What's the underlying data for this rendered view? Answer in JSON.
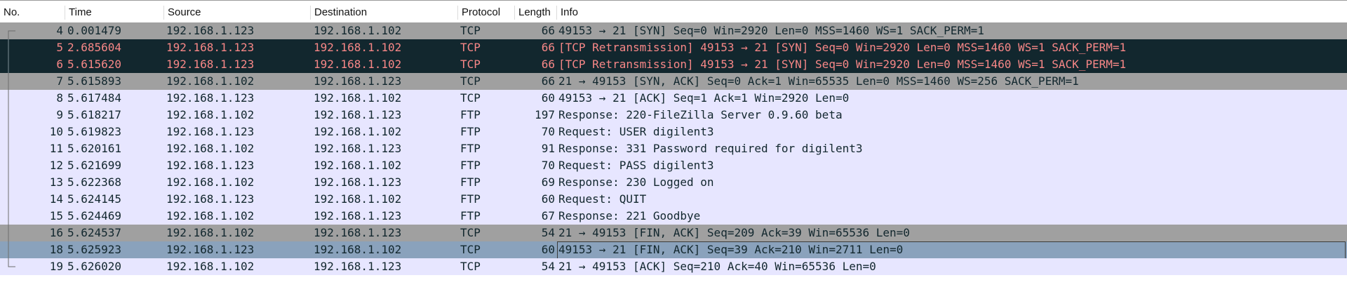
{
  "columns": {
    "no": "No.",
    "time": "Time",
    "source": "Source",
    "destination": "Destination",
    "protocol": "Protocol",
    "length": "Length",
    "info": "Info"
  },
  "colors": {
    "tcp_row_bg": "#a0a0a0",
    "ftp_row_bg": "#e7e6ff",
    "bad_tcp_bg": "#12272e",
    "bad_tcp_fg": "#f78787",
    "selected_bg": "#8aa2bc",
    "row_fg": "#12272e"
  },
  "packets": [
    {
      "no": "4",
      "time": "0.001479",
      "source": "192.168.1.123",
      "destination": "192.168.1.102",
      "protocol": "TCP",
      "length": "66",
      "info": "49153 → 21 [SYN] Seq=0 Win=2920 Len=0 MSS=1460 WS=1 SACK_PERM=1",
      "style": "tcp",
      "tree": "first"
    },
    {
      "no": "5",
      "time": "2.685604",
      "source": "192.168.1.123",
      "destination": "192.168.1.102",
      "protocol": "TCP",
      "length": "66",
      "info": "[TCP Retransmission] 49153 → 21 [SYN] Seq=0 Win=2920 Len=0 MSS=1460 WS=1 SACK_PERM=1",
      "style": "bad",
      "tree": "line"
    },
    {
      "no": "6",
      "time": "5.615620",
      "source": "192.168.1.123",
      "destination": "192.168.1.102",
      "protocol": "TCP",
      "length": "66",
      "info": "[TCP Retransmission] 49153 → 21 [SYN] Seq=0 Win=2920 Len=0 MSS=1460 WS=1 SACK_PERM=1",
      "style": "bad",
      "tree": "line"
    },
    {
      "no": "7",
      "time": "5.615893",
      "source": "192.168.1.102",
      "destination": "192.168.1.123",
      "protocol": "TCP",
      "length": "66",
      "info": "21 → 49153 [SYN, ACK] Seq=0 Ack=1 Win=65535 Len=0 MSS=1460 WS=256 SACK_PERM=1",
      "style": "tcp",
      "tree": "line"
    },
    {
      "no": "8",
      "time": "5.617484",
      "source": "192.168.1.123",
      "destination": "192.168.1.102",
      "protocol": "TCP",
      "length": "60",
      "info": "49153 → 21 [ACK] Seq=1 Ack=1 Win=2920 Len=0",
      "style": "ftp",
      "tree": "line"
    },
    {
      "no": "9",
      "time": "5.618217",
      "source": "192.168.1.102",
      "destination": "192.168.1.123",
      "protocol": "FTP",
      "length": "197",
      "info": "Response: 220-FileZilla Server 0.9.60 beta",
      "style": "ftp",
      "tree": "line"
    },
    {
      "no": "10",
      "time": "5.619823",
      "source": "192.168.1.123",
      "destination": "192.168.1.102",
      "protocol": "FTP",
      "length": "70",
      "info": "Request: USER digilent3",
      "style": "ftp",
      "tree": "line"
    },
    {
      "no": "11",
      "time": "5.620161",
      "source": "192.168.1.102",
      "destination": "192.168.1.123",
      "protocol": "FTP",
      "length": "91",
      "info": "Response: 331 Password required for digilent3",
      "style": "ftp",
      "tree": "line"
    },
    {
      "no": "12",
      "time": "5.621699",
      "source": "192.168.1.123",
      "destination": "192.168.1.102",
      "protocol": "FTP",
      "length": "70",
      "info": "Request: PASS digilent3",
      "style": "ftp",
      "tree": "line"
    },
    {
      "no": "13",
      "time": "5.622368",
      "source": "192.168.1.102",
      "destination": "192.168.1.123",
      "protocol": "FTP",
      "length": "69",
      "info": "Response: 230 Logged on",
      "style": "ftp",
      "tree": "line"
    },
    {
      "no": "14",
      "time": "5.624145",
      "source": "192.168.1.123",
      "destination": "192.168.1.102",
      "protocol": "FTP",
      "length": "60",
      "info": "Request: QUIT",
      "style": "ftp",
      "tree": "line"
    },
    {
      "no": "15",
      "time": "5.624469",
      "source": "192.168.1.102",
      "destination": "192.168.1.123",
      "protocol": "FTP",
      "length": "67",
      "info": "Response: 221 Goodbye",
      "style": "ftp",
      "tree": "line"
    },
    {
      "no": "16",
      "time": "5.624537",
      "source": "192.168.1.102",
      "destination": "192.168.1.123",
      "protocol": "TCP",
      "length": "54",
      "info": "21 → 49153 [FIN, ACK] Seq=209 Ack=39 Win=65536 Len=0",
      "style": "tcp",
      "tree": "line"
    },
    {
      "no": "18",
      "time": "5.625923",
      "source": "192.168.1.123",
      "destination": "192.168.1.102",
      "protocol": "TCP",
      "length": "60",
      "info": "49153 → 21 [FIN, ACK] Seq=39 Ack=210 Win=2711 Len=0",
      "style": "selected",
      "tree": "line"
    },
    {
      "no": "19",
      "time": "5.626020",
      "source": "192.168.1.102",
      "destination": "192.168.1.123",
      "protocol": "TCP",
      "length": "54",
      "info": "21 → 49153 [ACK] Seq=210 Ack=40 Win=65536 Len=0",
      "style": "ftp",
      "tree": "last"
    }
  ]
}
